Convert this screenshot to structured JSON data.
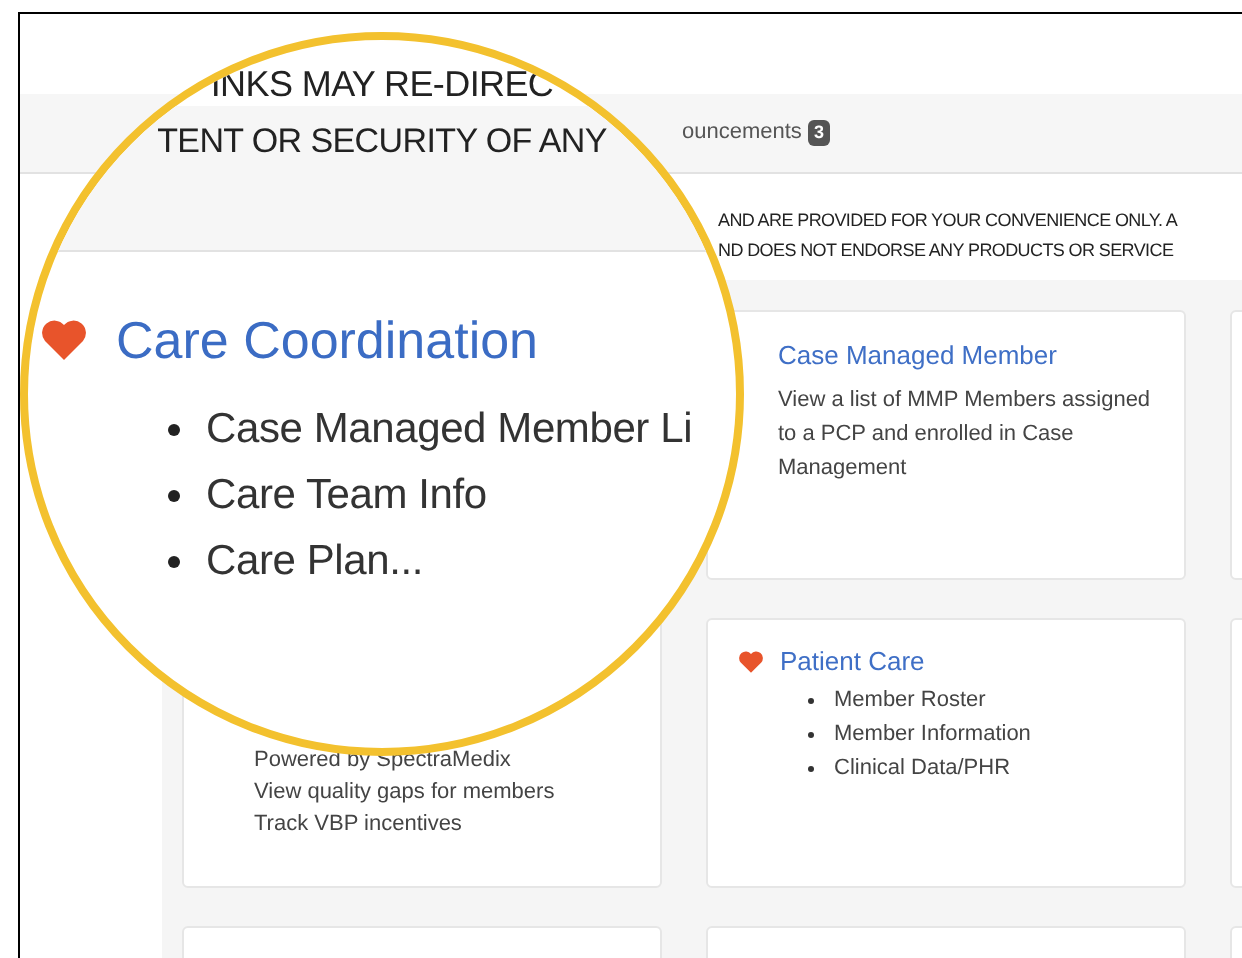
{
  "lens": {
    "heading_lines": [
      "INKS MAY RE-DIREC",
      "TENT OR SECURITY OF ANY"
    ],
    "section_title": "Care Coordination",
    "items": [
      "Case Managed Member Li",
      "Care Team Info",
      "Care Plan..."
    ]
  },
  "tab_bar": {
    "tab_label": "ouncements",
    "badge": "3"
  },
  "notice_lines": [
    "AND ARE PROVIDED FOR YOUR CONVENIENCE ONLY. A",
    "ND DOES NOT ENDORSE ANY PRODUCTS OR SERVICE"
  ],
  "cards": [
    {
      "kind": "description",
      "title": "Case Managed Member",
      "text": "View a list of MMP Members assigned to a PCP and enrolled in Case Management"
    },
    {
      "kind": "blank"
    },
    {
      "kind": "lines",
      "lines": [
        "Powered by SpectraMedix",
        "View quality gaps for members",
        "Track VBP incentives"
      ]
    },
    {
      "kind": "list",
      "title": "Patient Care",
      "items": [
        "Member Roster",
        "Member Information",
        "Clinical Data/PHR"
      ]
    },
    {
      "kind": "blank"
    },
    {
      "kind": "blank"
    },
    {
      "kind": "blank"
    },
    {
      "kind": "blank"
    }
  ]
}
